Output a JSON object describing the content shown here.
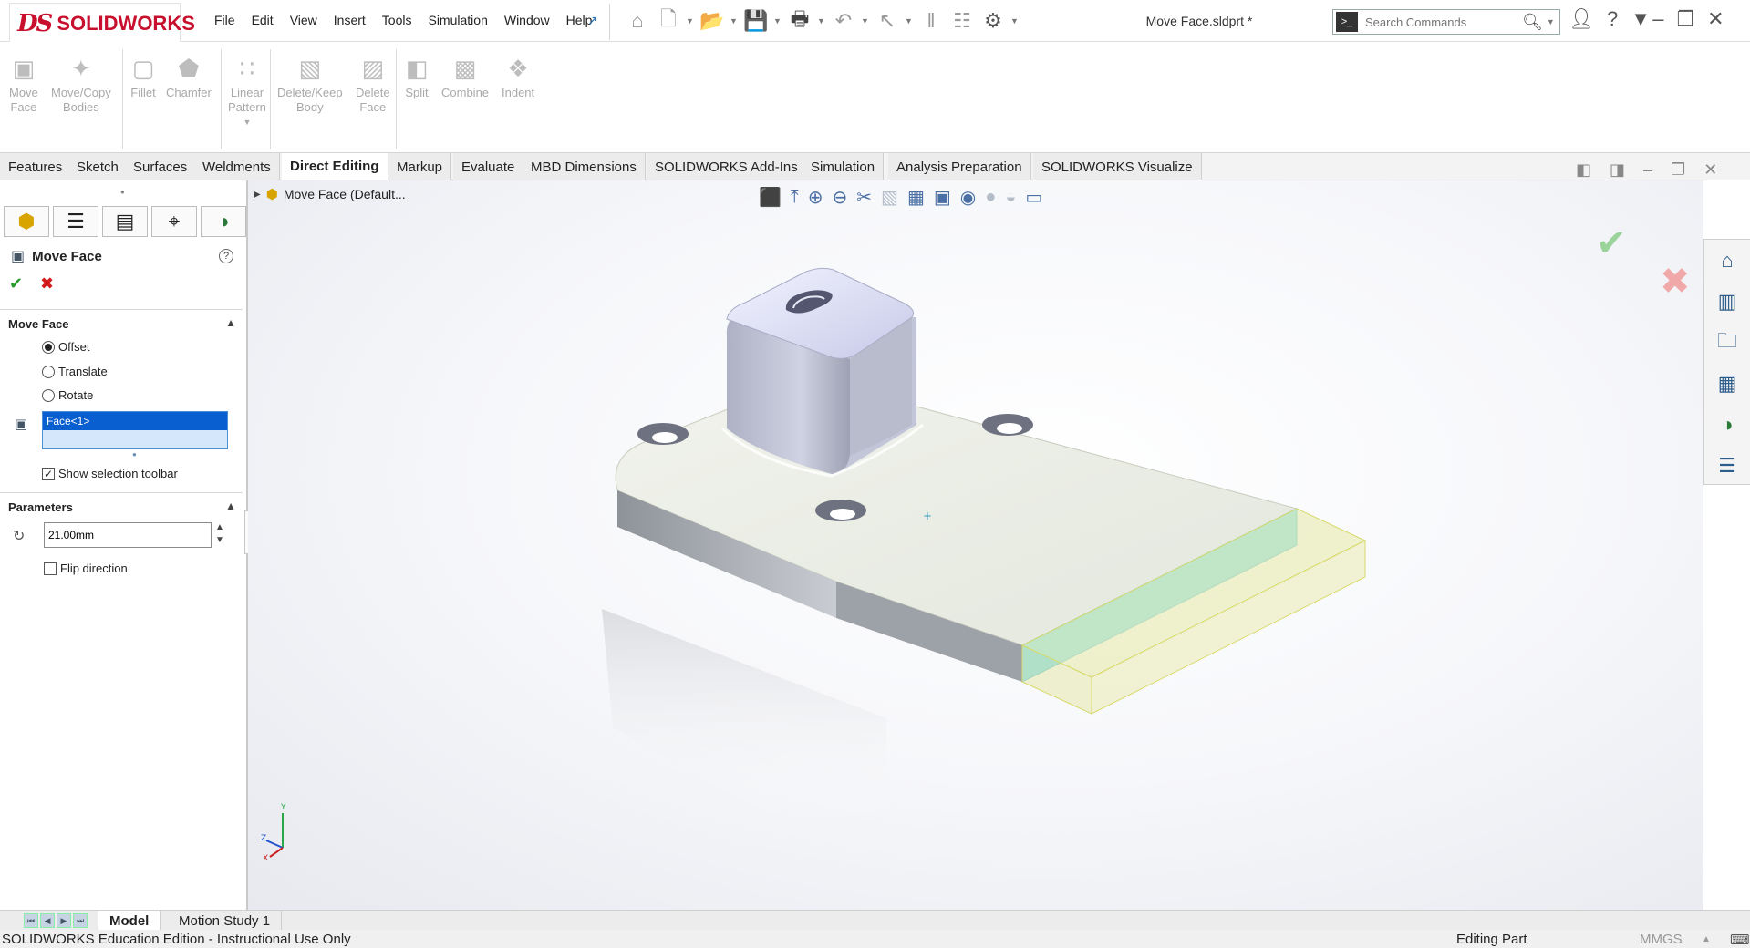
{
  "app": {
    "brand": "SOLIDWORKS",
    "brand_ds": "DS",
    "doc_title": "Move Face.sldprt *"
  },
  "menu": [
    "File",
    "Edit",
    "View",
    "Insert",
    "Tools",
    "Simulation",
    "Window",
    "Help"
  ],
  "search": {
    "placeholder": "Search Commands"
  },
  "ribbon": {
    "move_face": [
      "Move",
      "Face"
    ],
    "move_copy": [
      "Move/Copy",
      "Bodies"
    ],
    "fillet": "Fillet",
    "chamfer": "Chamfer",
    "linear_pattern": [
      "Linear",
      "Pattern"
    ],
    "delete_keep": [
      "Delete/Keep",
      "Body"
    ],
    "delete_face": [
      "Delete",
      "Face"
    ],
    "split": "Split",
    "combine": "Combine",
    "indent": "Indent"
  },
  "tabs": [
    "Features",
    "Sketch",
    "Surfaces",
    "Weldments",
    "Direct Editing",
    "Markup",
    "Evaluate",
    "MBD Dimensions",
    "SOLIDWORKS Add-Ins",
    "Simulation",
    "Analysis Preparation",
    "SOLIDWORKS Visualize"
  ],
  "active_tab": "Direct Editing",
  "property_manager": {
    "title": "Move Face",
    "section_move_face": "Move Face",
    "options": {
      "offset": "Offset",
      "translate": "Translate",
      "rotate": "Rotate"
    },
    "selected_option": "Offset",
    "selection": "Face<1>",
    "show_selection_toolbar": "Show selection toolbar",
    "section_parameters": "Parameters",
    "distance": "21.00mm",
    "flip_direction": "Flip direction"
  },
  "tree": {
    "node": "Move Face  (Default..."
  },
  "bottom_tabs": {
    "model": "Model",
    "motion_study": "Motion Study 1"
  },
  "status": {
    "left": "SOLIDWORKS Education Edition - Instructional Use Only",
    "mode": "Editing Part",
    "units": "MMGS"
  },
  "colors": {
    "accent": "#0a5fd0",
    "brand": "#c8102e",
    "selected_face": "#5fd6ea",
    "preview": "#e9ebb8"
  }
}
